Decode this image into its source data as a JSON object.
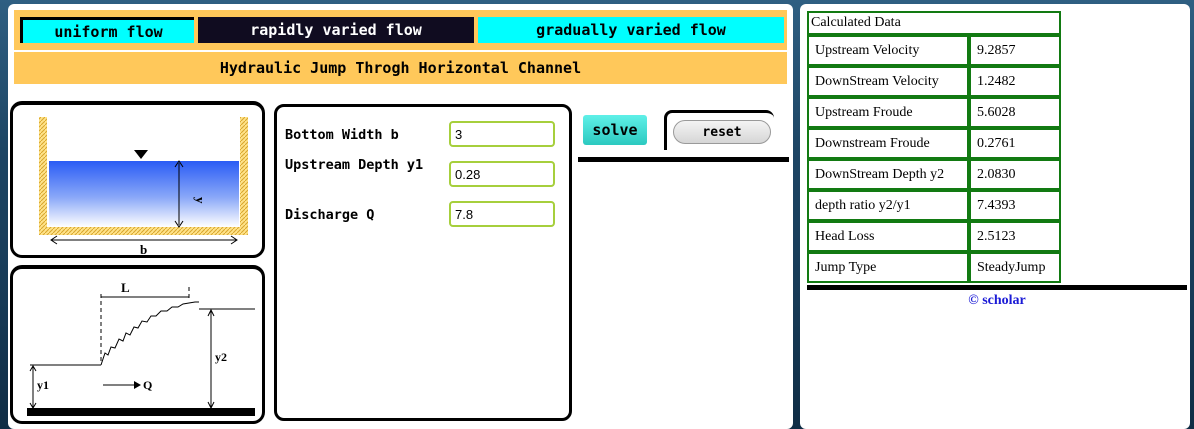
{
  "tabs": [
    {
      "label": "uniform flow"
    },
    {
      "label": "rapidly varied flow"
    },
    {
      "label": "gradually varied flow"
    }
  ],
  "title": "Hydraulic Jump Throgh Horizontal Channel",
  "diagram_top": {
    "depth_label": "y",
    "width_label": "b"
  },
  "diagram_bottom": {
    "length_label": "L",
    "y1_label": "y1",
    "y2_label": "y2",
    "q_label": "Q"
  },
  "form": {
    "bottom_width": {
      "label": "Bottom Width b",
      "value": "3"
    },
    "upstream_depth": {
      "label": "Upstream Depth y1",
      "value": "0.28"
    },
    "discharge": {
      "label": "Discharge Q",
      "value": "7.8"
    }
  },
  "buttons": {
    "solve": "solve",
    "reset": "reset"
  },
  "results": {
    "header": "Calculated Data",
    "rows": [
      {
        "label": "Upstream Velocity",
        "value": "9.2857"
      },
      {
        "label": "DownStream Velocity",
        "value": "1.2482"
      },
      {
        "label": "Upstream Froude",
        "value": "5.6028"
      },
      {
        "label": "Downstream Froude",
        "value": "0.2761"
      },
      {
        "label": "DownStream Depth y2",
        "value": "2.0830"
      },
      {
        "label": "depth ratio y2/y1",
        "value": "7.4393"
      },
      {
        "label": "Head Loss",
        "value": "2.5123"
      },
      {
        "label": "Jump Type",
        "value": "SteadyJump"
      }
    ]
  },
  "footer": {
    "copyright": "© scholar"
  },
  "colors": {
    "tab_active_bg": "#100c20",
    "tab_bg": "#00ffff",
    "header_bg": "#ffc85a",
    "table_border": "#127a12",
    "link": "#1b1bd6",
    "input_border": "#a6cf3c"
  }
}
